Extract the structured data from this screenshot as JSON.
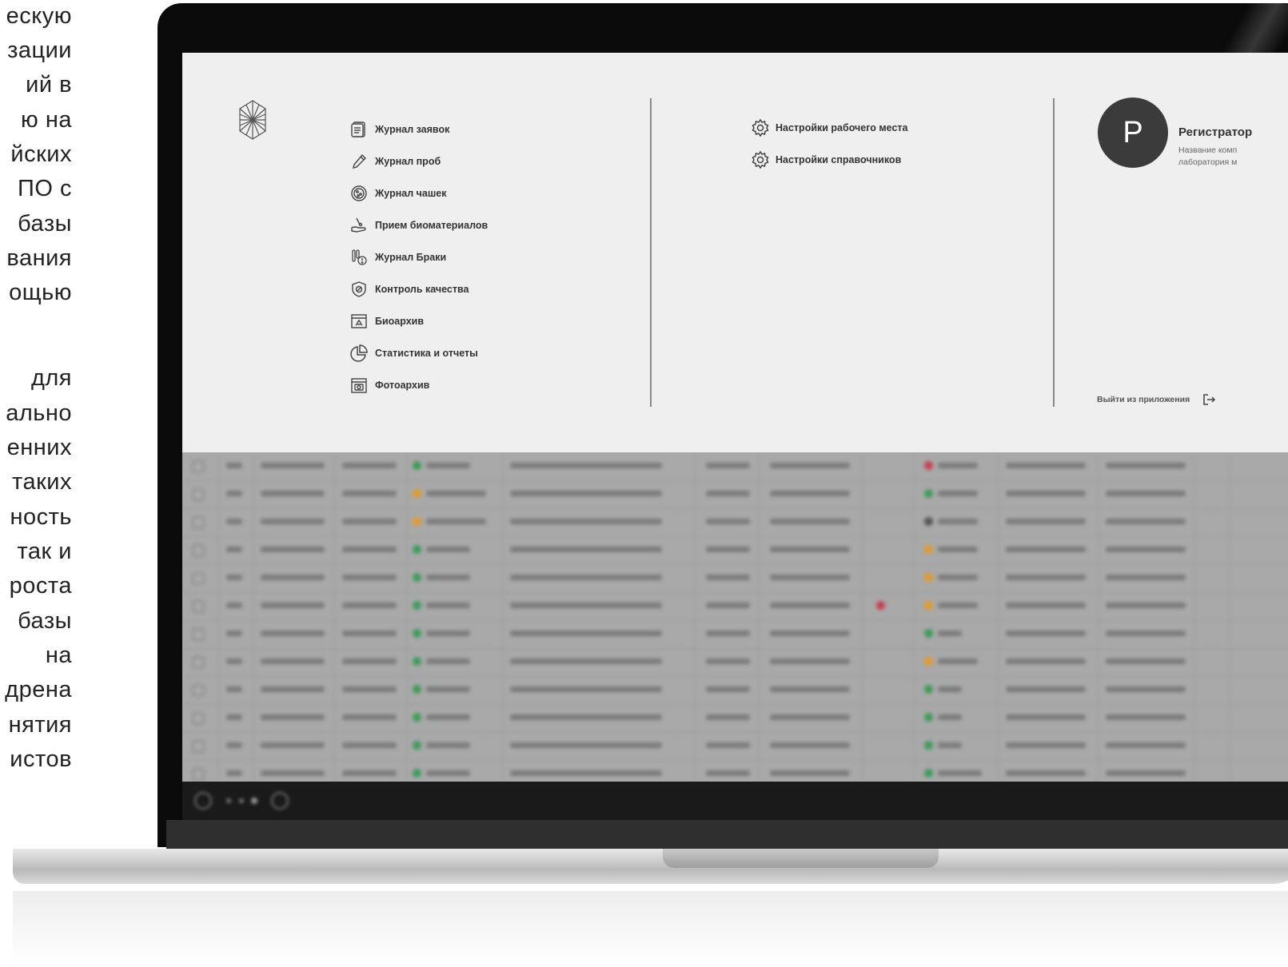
{
  "side_text": {
    "lines": [
      "ескую",
      "зации",
      "ий   в",
      "ю   на",
      "йских",
      "ПО   с",
      "базы",
      "вания",
      "ощью",
      "для",
      "ально",
      "енних",
      "таких",
      "ность",
      "так   и",
      "роста",
      "базы",
      "на",
      "дрена",
      "нятия",
      "истов"
    ]
  },
  "menu": {
    "nav_items": [
      {
        "label": "Журнал заявок",
        "icon": "journal-requests-icon"
      },
      {
        "label": "Журнал проб",
        "icon": "pipette-icon"
      },
      {
        "label": "Журнал чашек",
        "icon": "petri-dish-icon"
      },
      {
        "label": "Прием биоматериалов",
        "icon": "biomaterial-intake-icon"
      },
      {
        "label": "Журнал Браки",
        "icon": "defect-tubes-icon"
      },
      {
        "label": "Контроль качества",
        "icon": "quality-shield-icon"
      },
      {
        "label": "Биоархив",
        "icon": "bioarchive-box-icon"
      },
      {
        "label": "Статистика и отчеты",
        "icon": "pie-chart-icon"
      },
      {
        "label": "Фотоархив",
        "icon": "photo-archive-icon"
      }
    ],
    "settings_items": [
      {
        "label": "Настройки рабочего места",
        "icon": "gear-icon"
      },
      {
        "label": "Настройки справочников",
        "icon": "gear-icon"
      }
    ],
    "user": {
      "initial": "Р",
      "role": "Регистратор",
      "org_line1": "Название комп",
      "org_line2": "лаборатория м"
    },
    "logout_label": "Выйти из приложения"
  },
  "colors": {
    "screen_bg": "#efefef",
    "avatar_bg": "#3b3b3b",
    "status_green": "#3f9a5a",
    "status_orange": "#e39a2d",
    "status_red": "#c8404f"
  }
}
